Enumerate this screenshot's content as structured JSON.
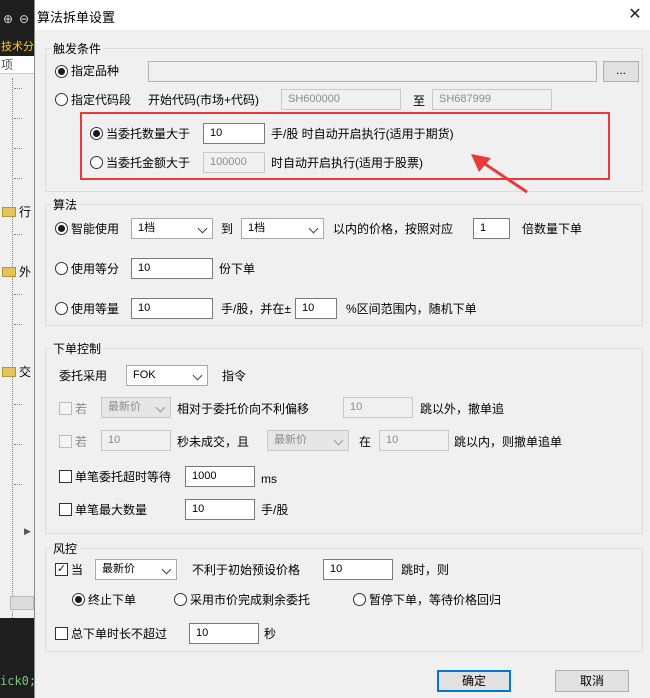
{
  "background_app": {
    "toolbar_icon1": "⊕",
    "toolbar_icon2": "⊖",
    "tech_label": "技术分",
    "column_header": "项",
    "tree_items": [
      "行",
      "外",
      "交"
    ],
    "code_lines": [
      "",
      "ick0;"
    ]
  },
  "dialog": {
    "title": "算法拆单设置",
    "close_icon": "close-icon",
    "trigger": {
      "group_title": "触发条件",
      "specify_instrument_label": "指定品种",
      "specify_instrument_value": "",
      "browse_button": "...",
      "specify_code_range_label": "指定代码段",
      "start_code_label": "开始代码(市场+代码)",
      "start_code_value": "SH600000",
      "to_label": "至",
      "end_code_value": "SH687999",
      "qty_trigger_label": "当委托数量大于",
      "qty_trigger_value": "10",
      "qty_trigger_suffix": "手/股 时自动开启执行(适用于期货)",
      "amount_trigger_label": "当委托金额大于",
      "amount_trigger_value": "100000",
      "amount_trigger_suffix": "时自动开启执行(适用于股票)"
    },
    "algorithm": {
      "group_title": "算法",
      "smart_label": "智能使用",
      "smart_from": "1档",
      "to_label": "到",
      "smart_to": "1档",
      "price_text": "以内的价格，按照对应",
      "multiple_value": "1",
      "multiple_suffix": "倍数量下单",
      "equal_parts_label": "使用等分",
      "equal_parts_value": "10",
      "equal_parts_suffix": "份下单",
      "equal_qty_label": "使用等量",
      "equal_qty_value": "10",
      "equal_qty_mid": "手/股，并在±",
      "range_value": "10",
      "range_suffix": "%区间范围内，随机下单"
    },
    "order_control": {
      "group_title": "下单控制",
      "order_type_label": "委托采用",
      "order_type_value": "FOK",
      "order_type_suffix": "指令",
      "if1_label": "若",
      "if1_price": "最新价",
      "if1_text": "相对于委托价向不利偏移",
      "if1_value": "10",
      "if1_suffix": "跳以外，撤单追",
      "if2_label": "若",
      "if2_value": "10",
      "if2_text": "秒未成交，且",
      "if2_price": "最新价",
      "if2_in": "在",
      "if2_range": "10",
      "if2_suffix": "跳以内，则撤单追单",
      "timeout_label": "单笔委托超时等待",
      "timeout_value": "1000",
      "timeout_unit": "ms",
      "max_qty_label": "单笔最大数量",
      "max_qty_value": "10",
      "max_qty_unit": "手/股"
    },
    "risk": {
      "group_title": "风控",
      "when_label": "当",
      "when_checked": true,
      "price_value": "最新价",
      "adverse_text": "不利于初始预设价格",
      "ticks_value": "10",
      "ticks_suffix": "跳时，则",
      "opt_stop": "终止下单",
      "opt_market": "采用市价完成剩余委托",
      "opt_pause": "暂停下单，等待价格回归",
      "total_time_label": "总下单时长不超过",
      "total_time_value": "10",
      "total_time_unit": "秒"
    },
    "buttons": {
      "ok": "确定",
      "cancel": "取消"
    },
    "colors": {
      "highlight_box": "#e83a3a",
      "default_button_border": "#0078d7"
    }
  }
}
